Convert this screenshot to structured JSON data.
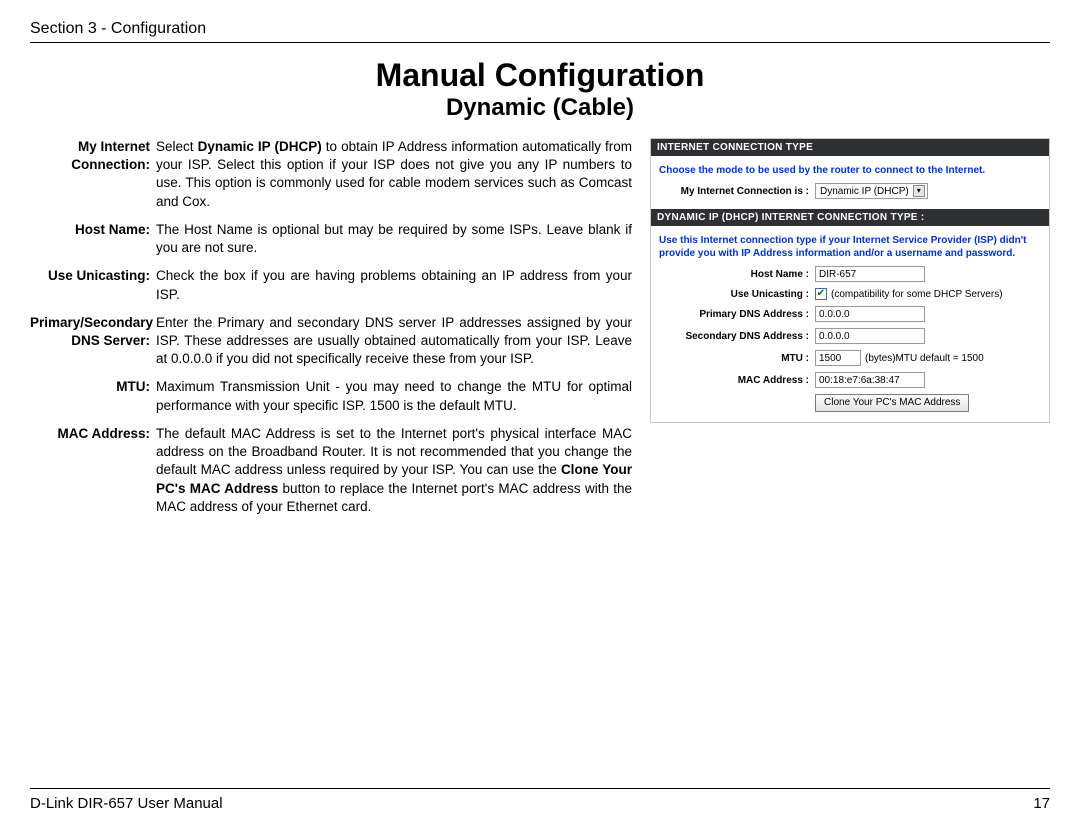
{
  "header": {
    "section_label": "Section 3 - Configuration"
  },
  "titles": {
    "main": "Manual Configuration",
    "sub": "Dynamic (Cable)"
  },
  "defs": {
    "my_internet_connection": {
      "term": "My Internet Connection:",
      "pre": "Select ",
      "bold": "Dynamic IP (DHCP)",
      "post": " to obtain IP Address information automatically from your ISP. Select this option if your ISP does not give you any IP numbers to use. This option is commonly used for cable modem services such as Comcast and Cox."
    },
    "host_name": {
      "term": "Host Name:",
      "text": "The Host Name is optional but may be required by some ISPs. Leave blank if you are not sure."
    },
    "use_unicasting": {
      "term": "Use Unicasting:",
      "text": "Check the box if you are having problems obtaining an IP address from your ISP."
    },
    "dns": {
      "term": "Primary/Secondary DNS Server:",
      "text": "Enter the Primary and secondary DNS server IP addresses assigned by your ISP. These addresses are usually obtained automatically from your ISP. Leave at 0.0.0.0 if you did not specifically receive these from your ISP."
    },
    "mtu": {
      "term": "MTU:",
      "text": "Maximum Transmission Unit - you may need to change the MTU for optimal performance with your specific ISP. 1500 is the default MTU."
    },
    "mac": {
      "term": "MAC Address:",
      "pre": "The default MAC Address is set to the Internet port's physical interface MAC address on the Broadband Router. It is not recommended that you change the default MAC address unless required by your ISP. You can use the ",
      "bold": "Clone Your PC's MAC Address",
      "post": " button to replace the Internet port's MAC address with the MAC address of your Ethernet card."
    }
  },
  "router": {
    "bar1": "INTERNET CONNECTION TYPE",
    "mode_hint": "Choose the mode to be used by the router to connect to the Internet.",
    "conn_label": "My Internet Connection is :",
    "conn_value": "Dynamic IP (DHCP)",
    "bar2": "DYNAMIC IP (DHCP) INTERNET CONNECTION TYPE :",
    "dhcp_hint": "Use this Internet connection type if your Internet Service Provider (ISP) didn't provide you with IP Address information and/or a username and password.",
    "fields": {
      "host_name_label": "Host Name :",
      "host_name_value": "DIR-657",
      "unicast_label": "Use Unicasting :",
      "unicast_note": "(compatibility for some DHCP Servers)",
      "primary_dns_label": "Primary DNS Address :",
      "primary_dns_value": "0.0.0.0",
      "secondary_dns_label": "Secondary DNS Address :",
      "secondary_dns_value": "0.0.0.0",
      "mtu_label": "MTU :",
      "mtu_value": "1500",
      "mtu_suffix": "(bytes)MTU default = 1500",
      "mac_label": "MAC Address :",
      "mac_value": "00:18:e7:6a:38:47",
      "clone_btn": "Clone Your PC's MAC Address"
    }
  },
  "footer": {
    "manual": "D-Link DIR-657 User Manual",
    "page": "17"
  }
}
